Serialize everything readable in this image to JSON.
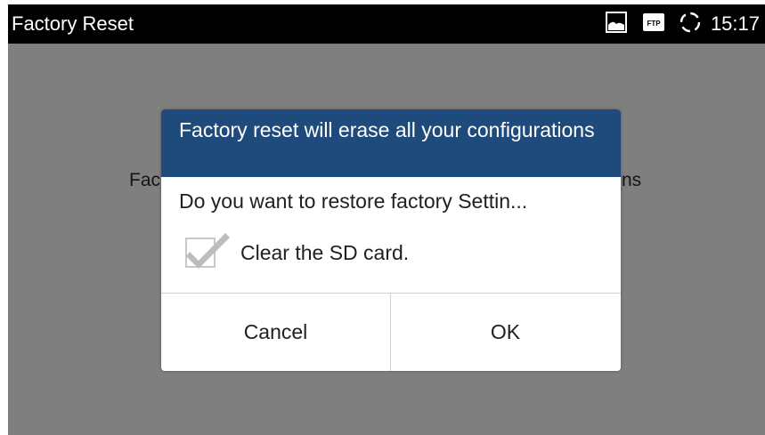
{
  "app": {
    "title": "Factory Reset"
  },
  "status_bar": {
    "time": "15:17",
    "icons": [
      "image-icon",
      "ftp-icon",
      "sync-icon"
    ],
    "ftp_label": "FTP"
  },
  "background": {
    "text_left": "Fac",
    "text_right": "ns"
  },
  "dialog": {
    "title": "Factory reset will erase all your configurations",
    "message": "Do you want to restore factory Settin...",
    "checkbox": {
      "label": "Clear the SD card.",
      "checked": true
    },
    "buttons": {
      "cancel": "Cancel",
      "ok": "OK"
    }
  },
  "colors": {
    "status_bar": "#000000",
    "dim_overlay": "#7f7f7f",
    "dialog_header": "#1f4b7c",
    "dialog_body": "#ffffff",
    "checkmark": "#bdbdbd"
  }
}
